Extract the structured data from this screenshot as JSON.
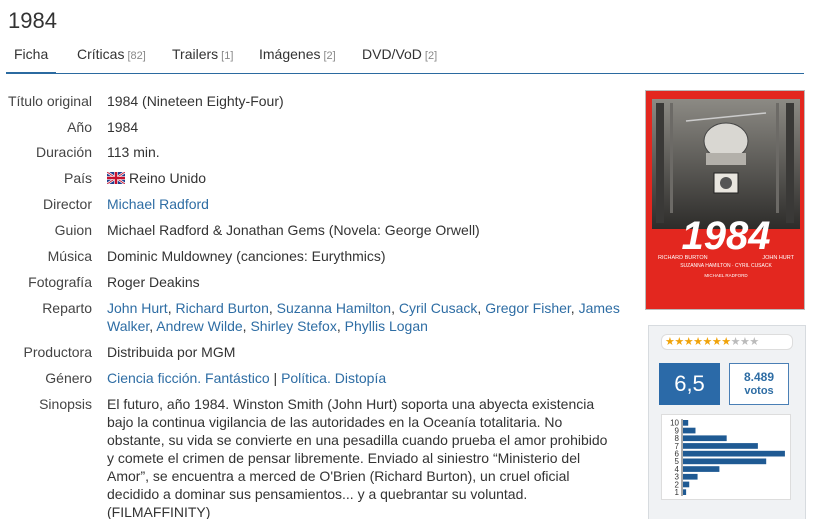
{
  "title": "1984",
  "tabs": [
    {
      "label": "Ficha",
      "count": ""
    },
    {
      "label": "Críticas",
      "count": "[82]"
    },
    {
      "label": "Trailers",
      "count": "[1]"
    },
    {
      "label": "Imágenes",
      "count": "[2]"
    },
    {
      "label": "DVD/VoD",
      "count": "[2]"
    }
  ],
  "ficha": {
    "titulo_original": {
      "label": "Título original",
      "value": "1984 (Nineteen Eighty-Four)"
    },
    "anio": {
      "label": "Año",
      "value": "1984"
    },
    "duracion": {
      "label": "Duración",
      "value": "113 min."
    },
    "pais": {
      "label": "País",
      "value": "Reino Unido"
    },
    "director": {
      "label": "Director",
      "value": "Michael Radford"
    },
    "guion": {
      "label": "Guion",
      "value": "Michael Radford & Jonathan Gems (Novela: George Orwell)"
    },
    "musica": {
      "label": "Música",
      "value": "Dominic Muldowney (canciones: Eurythmics)"
    },
    "fotografia": {
      "label": "Fotografía",
      "value": "Roger Deakins"
    },
    "reparto": {
      "label": "Reparto",
      "actors": [
        "John Hurt",
        "Richard Burton",
        "Suzanna Hamilton",
        "Cyril Cusack",
        "Gregor Fisher",
        "James Walker",
        "Andrew Wilde",
        "Shirley Stefox",
        "Phyllis Logan"
      ]
    },
    "productora": {
      "label": "Productora",
      "value": "Distribuida por MGM"
    },
    "genero": {
      "label": "Género",
      "items": [
        "Ciencia ficción",
        "Fantástico",
        "Política",
        "Distopía"
      ]
    },
    "sinopsis": {
      "label": "Sinopsis",
      "value": "El futuro, año 1984. Winston Smith (John Hurt) soporta una abyecta existencia bajo la continua vigilancia de las autoridades en la Oceanía totalitaria. No obstante, su vida se convierte en una pesadilla cuando prueba el amor prohibido y comete el crimen de pensar libremente. Enviado al siniestro “Ministerio del Amor”, se encuentra a merced de O'Brien (Richard Burton), un cruel oficial decidido a dominar sus pensamientos... y a quebrantar su voluntad. (FILMAFFINITY)"
    }
  },
  "poster": {
    "title_text": "1984",
    "credits": [
      "RICHARD BURTON",
      "JOHN HURT",
      "SUZANNA HAMILTON · CYRIL CUSACK",
      "MICHAEL RADFORD"
    ],
    "color": "#e3271f"
  },
  "rating": {
    "stars_on": 7,
    "stars_total": 10,
    "score": "6,5",
    "votes_count": "8.489",
    "votes_label": "votos",
    "histogram_labels": [
      "10",
      "9",
      "8",
      "7",
      "6",
      "5",
      "4",
      "3",
      "2",
      "1"
    ],
    "histogram_fractions": [
      0.05,
      0.12,
      0.42,
      0.72,
      0.98,
      0.8,
      0.35,
      0.14,
      0.06,
      0.03
    ],
    "accent_color": "#2b6aa8"
  },
  "icons": {
    "flag": "uk-flag-icon"
  }
}
